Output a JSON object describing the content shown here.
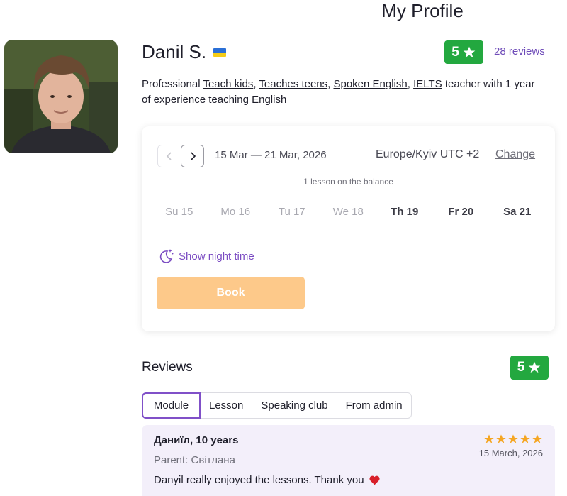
{
  "page": {
    "title": "My Profile"
  },
  "profile": {
    "name": "Danil S.",
    "rating": "5",
    "reviews_link": "28 reviews",
    "bio_prefix": "Professional ",
    "bio_tags": [
      "Teach kids",
      "Teaches teens",
      "Spoken English",
      "IELTS"
    ],
    "bio_suffix": " teacher with 1 year of experience teaching English"
  },
  "schedule": {
    "week_range": "15 Mar — 21 Mar, 2026",
    "timezone": "Europe/Kyiv UTC +2",
    "change_label": "Change",
    "balance": "1 lesson on the balance",
    "days": [
      "Su 15",
      "Mo 16",
      "Tu 17",
      "We 18",
      "Th 19",
      "Fr 20",
      "Sa 21"
    ],
    "night_time": "Show night time",
    "book_label": "Book"
  },
  "reviews": {
    "title": "Reviews",
    "rating": "5",
    "tabs": [
      "Module",
      "Lesson",
      "Speaking club",
      "From admin"
    ],
    "active_tab": "Module",
    "items": [
      {
        "author": "Даниїл, 10 years",
        "parent": "Parent: Світлана",
        "text": "Danyil really enjoyed the lessons. Thank you",
        "date": "15 March, 2026",
        "stars": 5
      }
    ]
  },
  "colors": {
    "accent": "#7a4bc2",
    "rating_green": "#23a83f",
    "book_orange": "#fdc98a",
    "star_gold": "#f5a623",
    "review_bg": "#f3effa"
  },
  "icons": [
    "ukraine-flag-icon",
    "star-icon",
    "chevron-left-icon",
    "chevron-right-icon",
    "moon-stars-icon",
    "heart-icon"
  ]
}
